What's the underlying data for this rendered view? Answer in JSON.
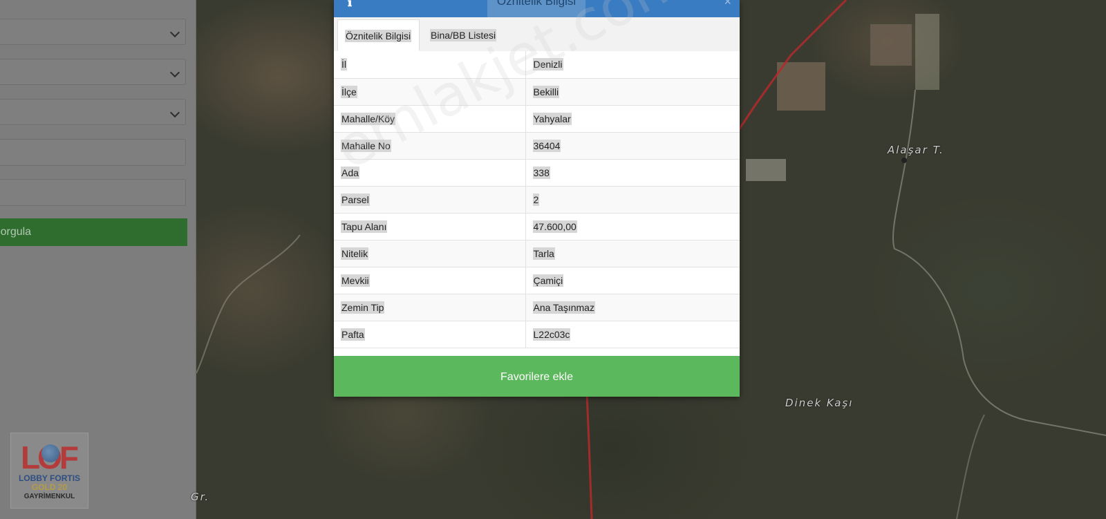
{
  "sidebar": {
    "query_button": "Sorgula"
  },
  "logo": {
    "mark": "LOF",
    "line1": "LOBBY FORTIS",
    "line2": "GOLD 20",
    "line3": "GAYRİMENKUL"
  },
  "map": {
    "labels": [
      "Alaşar T.",
      "Dinek Kaşı",
      "Gr."
    ]
  },
  "modal": {
    "title": "Öznitelik Bilgisi",
    "close": "×",
    "tabs": [
      {
        "label": "Öznitelik Bilgisi"
      },
      {
        "label": "Bina/BB Listesi"
      }
    ],
    "rows": [
      {
        "key": "İl",
        "value": "Denizli"
      },
      {
        "key": "İlçe",
        "value": "Bekilli"
      },
      {
        "key": "Mahalle/Köy",
        "value": "Yahyalar"
      },
      {
        "key": "Mahalle No",
        "value": "36404"
      },
      {
        "key": "Ada",
        "value": "338"
      },
      {
        "key": "Parsel",
        "value": "2"
      },
      {
        "key": "Tapu Alanı",
        "value": "47.600,00"
      },
      {
        "key": "Nitelik",
        "value": "Tarla"
      },
      {
        "key": "Mevkii",
        "value": "Çamiçi"
      },
      {
        "key": "Zemin Tip",
        "value": "Ana Taşınmaz"
      },
      {
        "key": "Pafta",
        "value": "L22c03c"
      }
    ],
    "favorite_button": "Favorilere ekle"
  },
  "watermark": "emlakjet.com",
  "colors": {
    "header": "#3a7cc2",
    "favorite": "#5cb85c",
    "query": "#2e6d2e"
  }
}
